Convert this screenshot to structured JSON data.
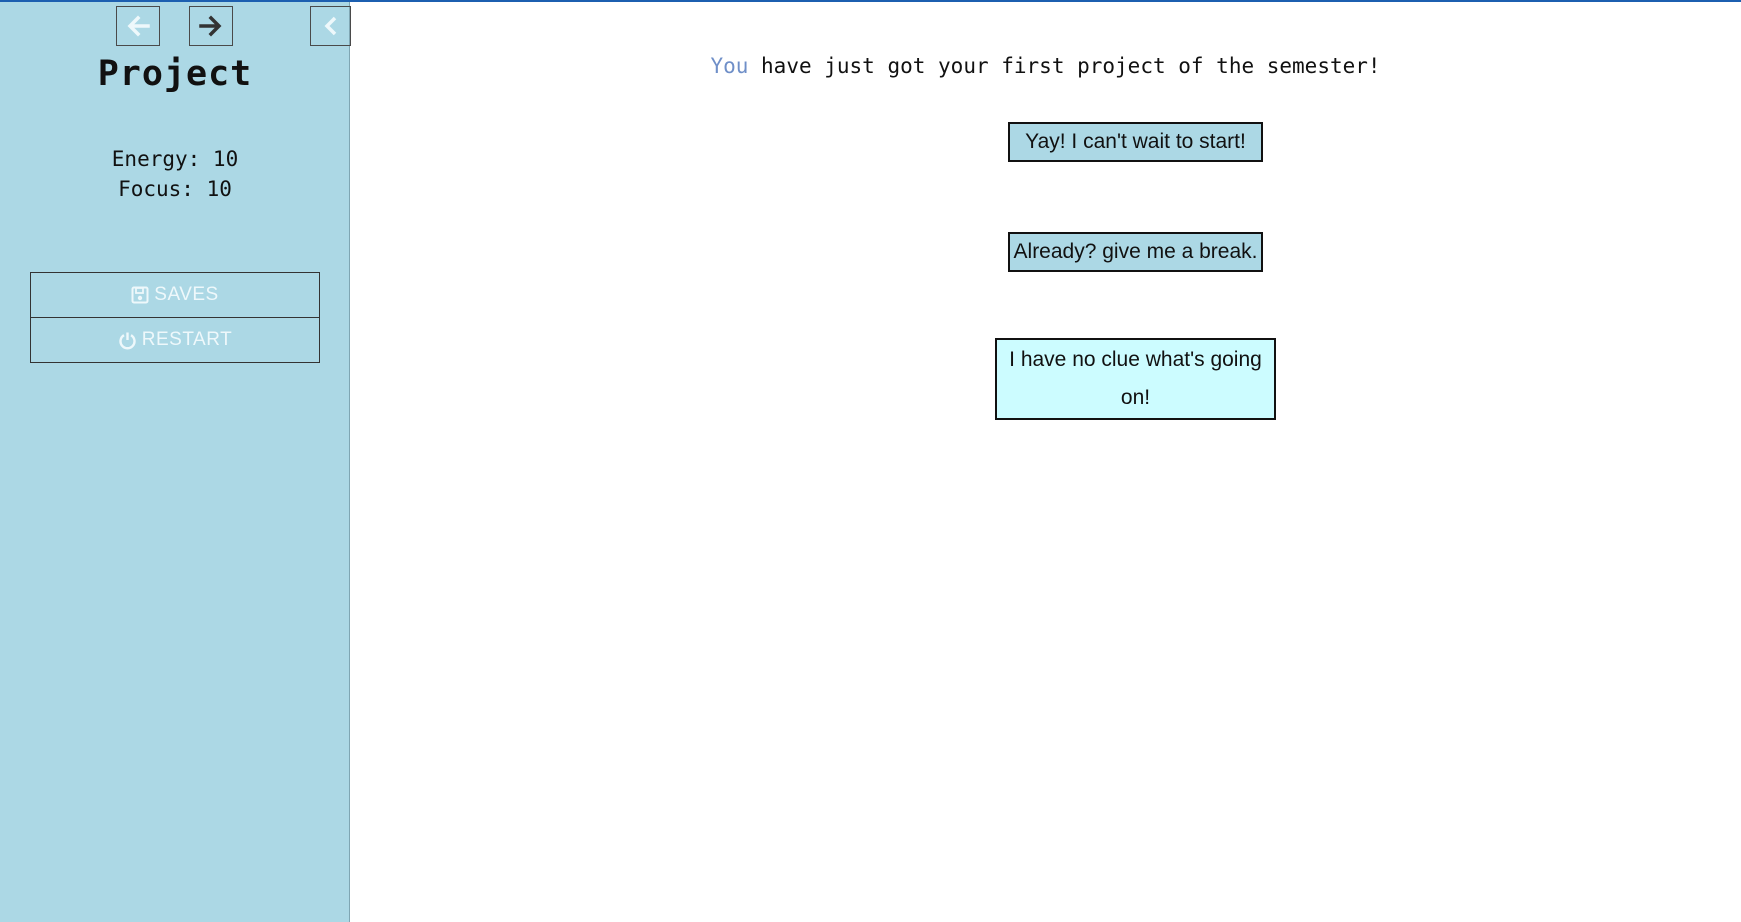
{
  "sidebar": {
    "nav": {
      "back_icon": "arrow-left-icon",
      "forward_icon": "arrow-right-icon",
      "collapse_icon": "chevron-left-icon"
    },
    "title": "Project",
    "stats": {
      "energy": "Energy: 10",
      "focus": "Focus: 10"
    },
    "menu": {
      "saves_label": "SAVES",
      "saves_icon": "floppy-disk-icon",
      "restart_label": "RESTART",
      "restart_icon": "power-icon"
    }
  },
  "passage": {
    "speaker": "You",
    "text": " have just got your first project of the semester!"
  },
  "choices": [
    {
      "label": "Yay! I can't wait to start!"
    },
    {
      "label": "Already? give me a break."
    },
    {
      "label": "I have no clue what's going on!"
    }
  ],
  "colors": {
    "sidebar_bg": "#acd8e5",
    "choice_bg": "#acd8e5",
    "choice_hover_bg": "#ccfcff",
    "speaker": "#6f8fc8",
    "top_line": "#1c5fb0"
  }
}
